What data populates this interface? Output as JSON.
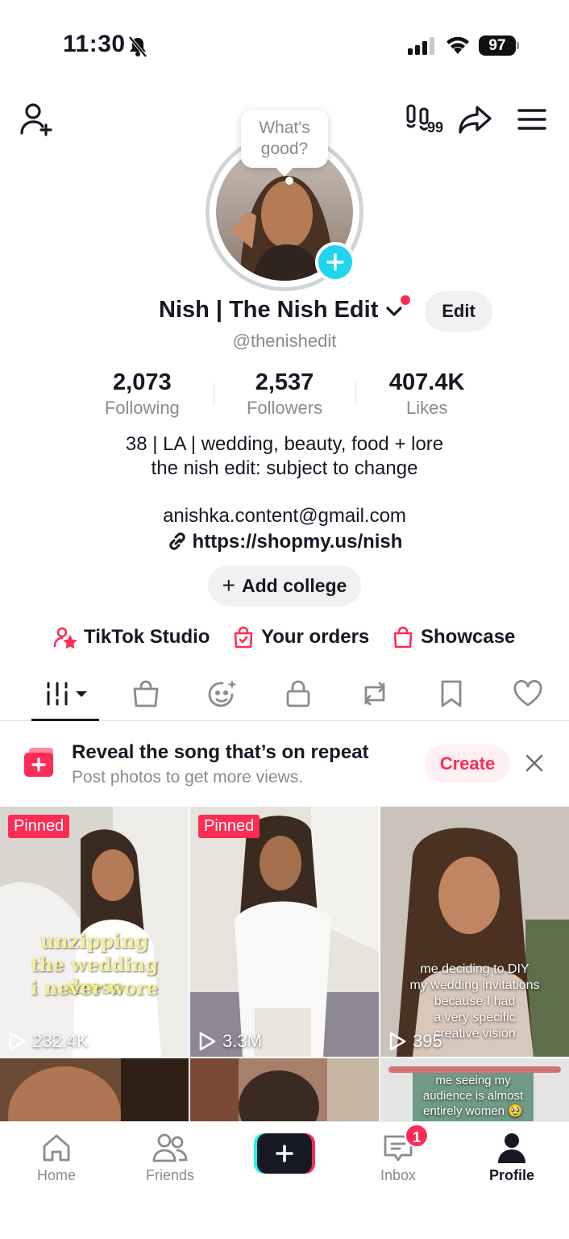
{
  "status_bar": {
    "time": "11:30",
    "battery": "97"
  },
  "top_bar": {
    "views_count": "99"
  },
  "profile": {
    "bubble_text": "What's good?",
    "display_name": "Nish | The Nish Edit",
    "edit_label": "Edit",
    "handle": "@thenishedit",
    "stats": [
      {
        "value": "2,073",
        "label": "Following"
      },
      {
        "value": "2,537",
        "label": "Followers"
      },
      {
        "value": "407.4K",
        "label": "Likes"
      }
    ],
    "bio_line1": "38 | LA | wedding, beauty, food + lore",
    "bio_line2": "the nish edit: subject to change",
    "email": "anishka.content@gmail.com",
    "link": "https://shopmy.us/nish",
    "add_college": "Add college"
  },
  "quick_links": [
    "TikTok Studio",
    "Your orders",
    "Showcase"
  ],
  "banner": {
    "title": "Reveal the song that’s on repeat",
    "subtitle": "Post photos to get more views.",
    "create_label": "Create"
  },
  "videos": [
    {
      "pinned": "Pinned",
      "views": "232.4K",
      "caption": [
        "unzipping",
        "the wedding dress",
        "i never wore"
      ]
    },
    {
      "pinned": "Pinned",
      "views": "3.3M"
    },
    {
      "views": "395",
      "caption": [
        "me deciding to DIY",
        "my wedding invitations",
        "because I had",
        "a very specific",
        "creative vision"
      ]
    },
    {
      "caption": [
        "me seeing my",
        "audience is almost",
        "entirely women 🥹"
      ]
    }
  ],
  "nav": {
    "home": "Home",
    "friends": "Friends",
    "inbox": "Inbox",
    "inbox_badge": "1",
    "profile": "Profile"
  },
  "colors": {
    "accent": "#fe2c55",
    "cyan": "#20d5ec",
    "text": "#161823",
    "muted": "#8a8b91"
  }
}
